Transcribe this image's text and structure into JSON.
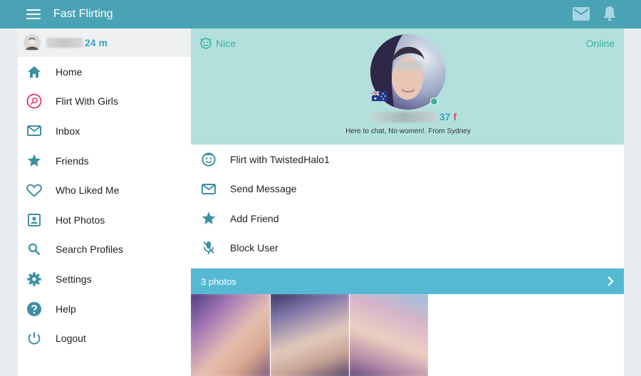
{
  "app": {
    "title": "Fast Flirting"
  },
  "topbar": {
    "mail_icon": "envelope-icon",
    "bell_icon": "bell-icon",
    "color": "#4aa3b4"
  },
  "user": {
    "age_sex": "24 m"
  },
  "nav": {
    "items": [
      {
        "label": "Home",
        "icon": "home-icon"
      },
      {
        "label": "Flirt With Girls",
        "icon": "flirt-target-icon"
      },
      {
        "label": "Inbox",
        "icon": "envelope-icon"
      },
      {
        "label": "Friends",
        "icon": "star-icon"
      },
      {
        "label": "Who Liked Me",
        "icon": "heart-icon"
      },
      {
        "label": "Hot Photos",
        "icon": "portrait-icon"
      },
      {
        "label": "Search Profiles",
        "icon": "search-icon"
      },
      {
        "label": "Settings",
        "icon": "gear-icon"
      },
      {
        "label": "Help",
        "icon": "help-icon"
      },
      {
        "label": "Logout",
        "icon": "power-icon"
      }
    ]
  },
  "profile": {
    "mood": "Nice",
    "status": "Online",
    "age": "37",
    "sex": "f",
    "tagline": "Here to chat, No women!. From Sydney",
    "header_color": "#b3e0dc"
  },
  "actions": [
    {
      "label": "Flirt with TwistedHalo1",
      "icon": "smiley-icon"
    },
    {
      "label": "Send Message",
      "icon": "envelope-icon"
    },
    {
      "label": "Add Friend",
      "icon": "star-icon"
    },
    {
      "label": "Block User",
      "icon": "mic-off-icon"
    }
  ],
  "photos": {
    "label": "3 photos",
    "bar_color": "#55b9d3"
  }
}
